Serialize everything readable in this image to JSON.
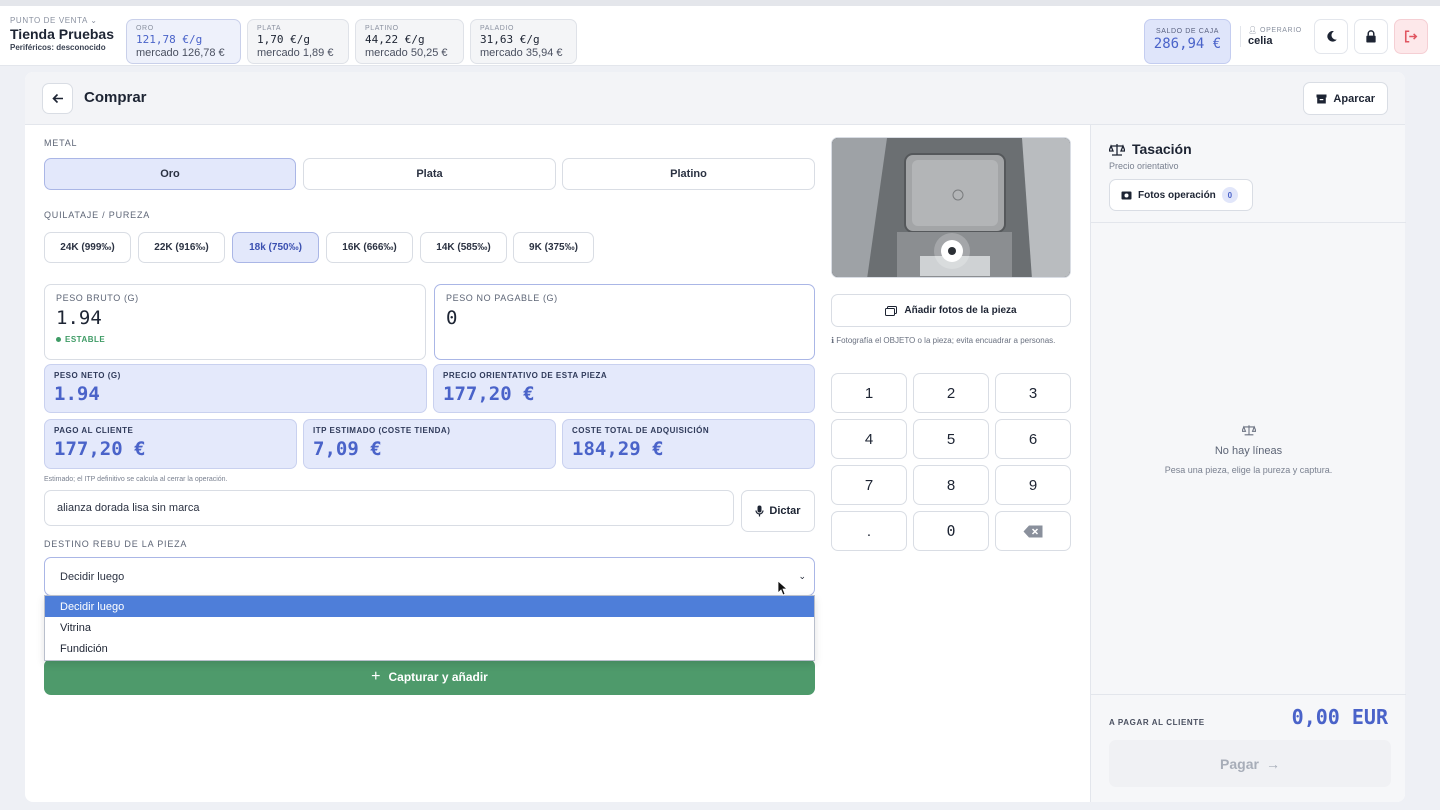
{
  "topbar": {
    "store_label": "PUNTO DE VENTA",
    "store_name": "Tienda Pruebas",
    "peripherals": "Periféricos: desconocido",
    "prices": [
      {
        "label": "ORO",
        "value": "121,78 €/g",
        "market": "mercado 126,78 €"
      },
      {
        "label": "PLATA",
        "value": "1,70 €/g",
        "market": "mercado 1,89 €"
      },
      {
        "label": "PLATINO",
        "value": "44,22 €/g",
        "market": "mercado 50,25 €"
      },
      {
        "label": "PALADIO",
        "value": "31,63 €/g",
        "market": "mercado 35,94 €"
      }
    ],
    "saldo_label": "SALDO DE CAJA",
    "saldo_value": "286,94 €",
    "operario_label": "OPERARIO",
    "operario_name": "celia"
  },
  "page": {
    "title": "Comprar",
    "aparcar_label": "Aparcar"
  },
  "metal": {
    "label": "METAL",
    "options": [
      "Oro",
      "Plata",
      "Platino"
    ],
    "selected": "Oro"
  },
  "purity": {
    "label": "QUILATAJE / PUREZA",
    "options": [
      "24K (999‰)",
      "22K (916‰)",
      "18k (750‰)",
      "16K (666‰)",
      "14K (585‰)",
      "9K (375‰)"
    ],
    "selected": "18k (750‰)"
  },
  "fields": {
    "peso_bruto_label": "PESO BRUTO (G)",
    "peso_bruto_value": "1.94",
    "peso_bruto_status": "ESTABLE",
    "peso_no_pagable_label": "PESO NO PAGABLE (G)",
    "peso_no_pagable_value": "0",
    "peso_neto_label": "PESO NETO (G)",
    "peso_neto_value": "1.94",
    "precio_label": "PRECIO ORIENTATIVO DE ESTA PIEZA",
    "precio_value": "177,20 €",
    "pago_label": "PAGO AL CLIENTE",
    "pago_value": "177,20 €",
    "itp_label": "ITP ESTIMADO (COSTE TIENDA)",
    "itp_value": "7,09 €",
    "coste_label": "COSTE TOTAL DE ADQUISICIÓN",
    "coste_value": "184,29 €",
    "itp_note": "Estimado; el ITP definitivo se calcula al cerrar la operación."
  },
  "description": {
    "value": "alianza dorada lisa sin marca",
    "dictar_label": "Dictar"
  },
  "destino": {
    "label": "DESTINO REBU DE LA PIEZA",
    "selected": "Decidir luego",
    "options": [
      "Decidir luego",
      "Vitrina",
      "Fundición"
    ]
  },
  "capture_label": "Capturar y añadir",
  "camera": {
    "add_photos_label": "Añadir fotos de la pieza",
    "photo_note": "Fotografía el OBJETO o la pieza; evita encuadrar a personas."
  },
  "keypad": [
    "1",
    "2",
    "3",
    "4",
    "5",
    "6",
    "7",
    "8",
    "9",
    ".",
    "0"
  ],
  "side": {
    "title": "Tasación",
    "subtitle": "Precio orientativo",
    "fotos_label": "Fotos operación",
    "fotos_count": "0",
    "empty_title": "No hay líneas",
    "empty_sub": "Pesa una pieza, elige la pureza y captura.",
    "pay_label": "A PAGAR AL CLIENTE",
    "pay_value": "0,00 EUR",
    "pay_button": "Pagar"
  },
  "colors": {
    "accent": "#4a63c9",
    "selected_bg": "#e3e8fb",
    "success": "#4e9a6b",
    "danger": "#e05560"
  }
}
